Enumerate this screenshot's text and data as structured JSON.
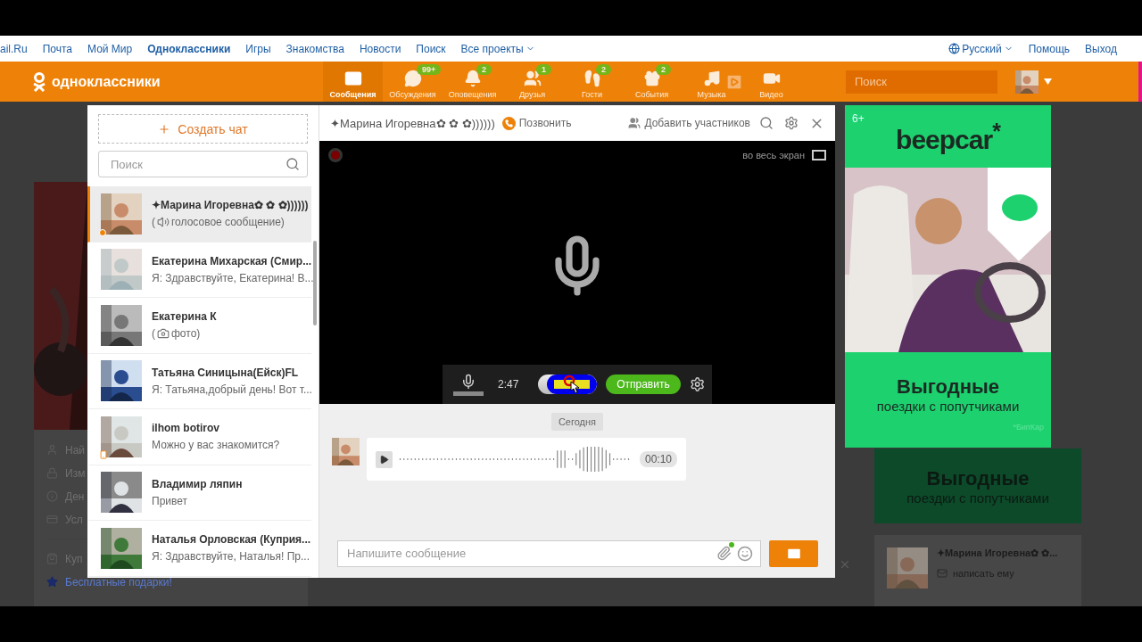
{
  "topbar": {
    "links": [
      {
        "label": "ail.Ru",
        "selected": false
      },
      {
        "label": "Почта",
        "selected": false
      },
      {
        "label": "Мой Мир",
        "selected": false
      },
      {
        "label": "Одноклассники",
        "selected": true
      },
      {
        "label": "Игры",
        "selected": false
      },
      {
        "label": "Знакомства",
        "selected": false
      },
      {
        "label": "Новости",
        "selected": false
      },
      {
        "label": "Поиск",
        "selected": false
      }
    ],
    "projects": "Все проекты",
    "language": "Русский",
    "help": "Помощь",
    "logout": "Выход"
  },
  "header": {
    "logo": "одноклассники",
    "nav": [
      {
        "label": "Сообщения",
        "selected": true
      },
      {
        "label": "Обсуждения",
        "badge": "99+",
        "selected": false
      },
      {
        "label": "Оповещения",
        "badge": "2",
        "selected": false
      },
      {
        "label": "Друзья",
        "badge": "1",
        "selected": false
      },
      {
        "label": "Гости",
        "badge": "2",
        "selected": false
      },
      {
        "label": "События",
        "badge": "2",
        "selected": false
      },
      {
        "label": "Музыка",
        "selected": false
      },
      {
        "label": "Видео",
        "selected": false
      }
    ],
    "search": {
      "placeholder": "Поиск"
    }
  },
  "background": {
    "menu": [
      "Най",
      "Изм",
      "Ден",
      "Усл",
      "Куп"
    ],
    "gifts": "Бесплатные подарки!",
    "ad": {
      "title": "Выгодные",
      "subtitle": "поездки с попутчиками"
    },
    "contact": {
      "name": "✦Марина Игоревна✿ ✿...",
      "action": "написать ему"
    }
  },
  "chat_list": {
    "create": "Создать чат",
    "search": {
      "placeholder": "Поиск"
    },
    "items": [
      {
        "kind": "voice",
        "name": "✦Марина Игоревна✿ ✿ ✿))))))",
        "preview_before": "(",
        "preview": "голосовое сообщение)",
        "online": true,
        "mobile": false,
        "selected": true
      },
      {
        "kind": "text",
        "name": "Екатерина Михарская (Смир...",
        "preview": "Я: Здравствуйте, Екатерина! В...",
        "online": false,
        "mobile": false,
        "selected": false
      },
      {
        "name": "Екатерина К",
        "preview_before": "(",
        "preview": "фото)",
        "online": false,
        "mobile": false,
        "selected": false
      },
      {
        "kind": "text",
        "name": "Татьяна Синицына(Ейск)FL",
        "preview": "Я: Татьяна,добрый день! Вот т...",
        "online": false,
        "mobile": false,
        "selected": false
      },
      {
        "kind": "text",
        "name": "ilhom botirov",
        "preview": "Можно у вас знакомится?",
        "online": false,
        "mobile": true,
        "selected": false
      },
      {
        "kind": "text",
        "name": "Владимир ляпин",
        "preview": "Привет",
        "online": false,
        "mobile": false,
        "selected": false
      },
      {
        "kind": "text",
        "name": "Наталья Орловская (Куприя...",
        "preview": "Я: Здравствуйте, Наталья! Пр...",
        "online": false,
        "mobile": false,
        "selected": false
      }
    ]
  },
  "chat": {
    "title": "✦Марина Игоревна✿ ✿ ✿))))))",
    "call": "Позвонить",
    "add_members": "Добавить участников",
    "recorder": {
      "fullscreen": "во весь экран",
      "time": "2:47",
      "send": "Отправить",
      "cursor_highlight": true
    },
    "date": "Сегодня",
    "messages": [
      {
        "kind": "voice",
        "duration": "00:10"
      }
    ],
    "input": {
      "placeholder": "Напишите сообщение"
    }
  },
  "ad": {
    "age": "6+",
    "brand": "beepcar$^{*}$",
    "title": "Выгодные",
    "subtitle": "поездки с попутчиками",
    "note": "*БипКар"
  }
}
